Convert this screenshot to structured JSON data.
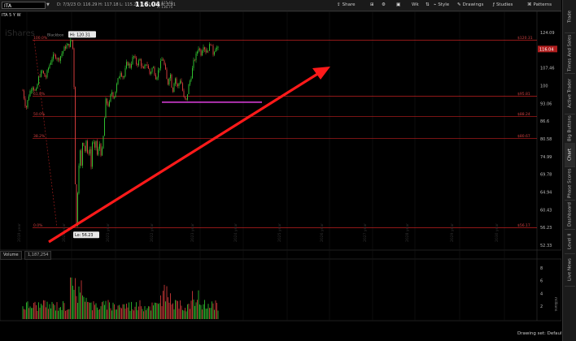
{
  "toolbar": {
    "symbol": "ITA",
    "date": "D: 7/3/23",
    "open": "O: 116.29",
    "high": "H: 117.18",
    "low": "L: 115.26",
    "close": "C: 116.04",
    "range": "R: 1.91",
    "description": "ISHARES TRUST US AER DEF ETF",
    "last_price": "116.04",
    "bid": "B: 115.43",
    "ask": "A: 116.75",
    "share_label": "Share",
    "timeframe_label": "Wk",
    "style_label": "Style",
    "drawings_label": "Drawings",
    "studies_label": "Studies",
    "patterns_label": "Patterns"
  },
  "chart": {
    "header": "ITA 5 Y W",
    "watermark": "iShares",
    "hi_label": "Hi: 120.31",
    "lo_label": "Lo: 56.23",
    "fib_ratio_labels": [
      "100.0%",
      "61.8%",
      "50.0%",
      "38.2%",
      "0.0%"
    ],
    "fib_price_labels": [
      "$120.31",
      "$95.81",
      "$88.24",
      "$80.67",
      "$56.17"
    ],
    "price_ticks": [
      "124.09",
      "115.78",
      "107.46",
      "100",
      "93.06",
      "86.6",
      "80.58",
      "74.99",
      "69.78",
      "64.94",
      "60.43",
      "56.23",
      "52.33"
    ],
    "current_price_tag": "116.04",
    "year_labels": [
      "2019 year",
      "2020 year",
      "2021 year",
      "2022 year",
      "2023 year",
      "2024 year",
      "2025 year",
      "2026 year",
      "2027 year",
      "2028 year",
      "2029 year",
      "2030 year"
    ],
    "time_ticks": [
      "19",
      "20",
      "21",
      "22",
      "23",
      "24",
      "25",
      "26",
      "27",
      "28",
      "29",
      "30"
    ],
    "cursor_label": "Blackbox"
  },
  "volume": {
    "label": "Volume",
    "count": "1,187,254",
    "ticks": [
      "8",
      "6",
      "4",
      "2"
    ],
    "unit_label": "millions"
  },
  "sidebar": {
    "tabs": [
      "Trade",
      "Times And Sales",
      "Active Trader",
      "Big Buttons",
      "Chart",
      "Phase Scores",
      "Dashboard",
      "Level II",
      "Live News"
    ]
  },
  "footer": {
    "drawing_set": "Drawing set: Default"
  },
  "colors": {
    "up": "#2fbf2f",
    "down": "#d23b3b",
    "fib_line": "#c02020",
    "support_line": "#e040e0",
    "arrow": "#ff1a1a"
  }
}
